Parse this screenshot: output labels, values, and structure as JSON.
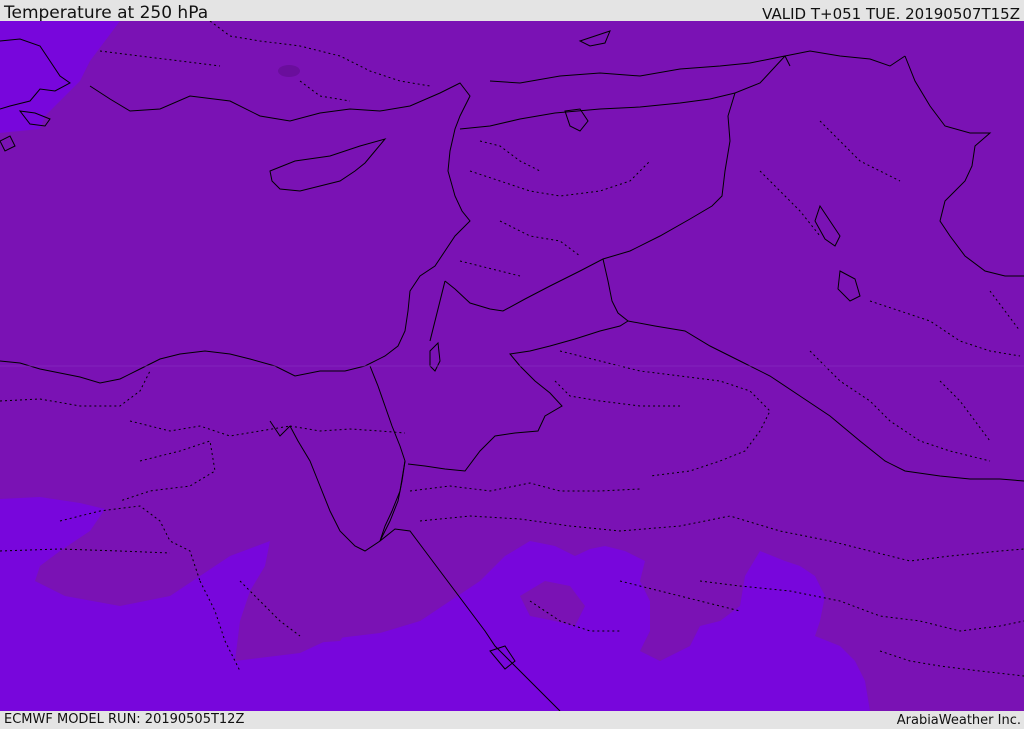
{
  "header": {
    "title": "Temperature at 250 hPa",
    "valid": "VALID T+051 TUE. 20190507T15Z"
  },
  "footer": {
    "model_run": "ECMWF MODEL RUN: 20190505T12Z",
    "credit": "ArabiaWeather Inc."
  },
  "colors": {
    "field_main": "#7a12b4",
    "field_warm": "#7806dc",
    "field_cold_spot": "#6a0e9c",
    "borders": "#000000",
    "frame": "#e4e4e4"
  }
}
